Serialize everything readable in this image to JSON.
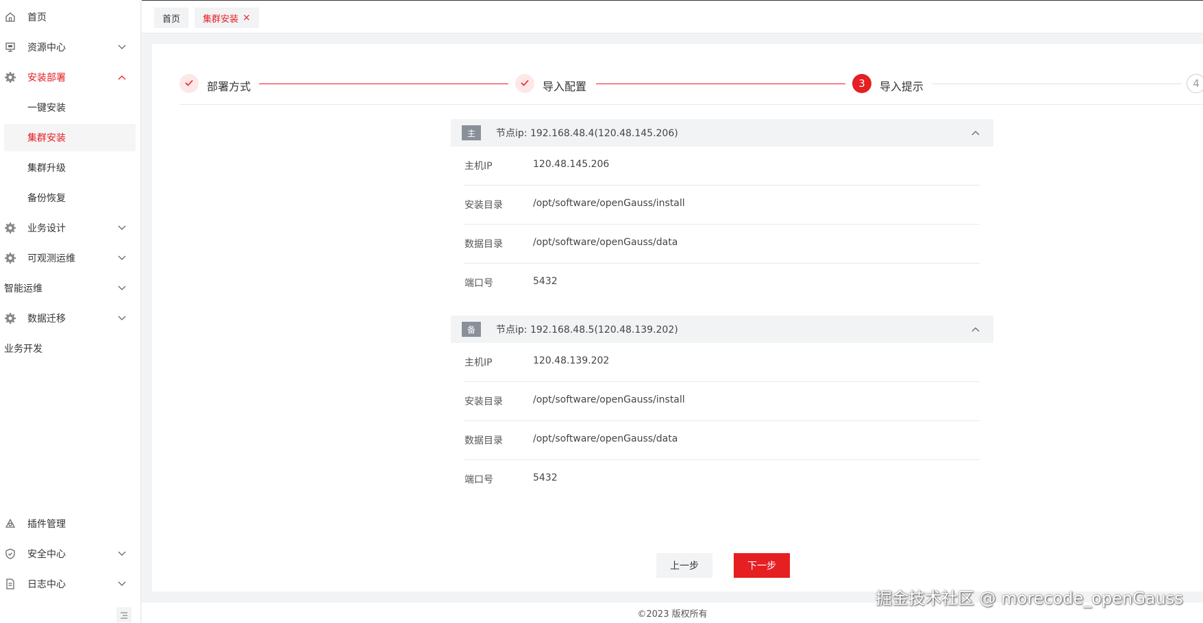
{
  "sidebar": {
    "items": [
      {
        "label": "首页",
        "icon": "home-icon"
      },
      {
        "label": "资源中心",
        "icon": "monitor-icon"
      },
      {
        "label": "安装部署",
        "icon": "gear-icon"
      },
      {
        "label": "一键安装"
      },
      {
        "label": "集群安装"
      },
      {
        "label": "集群升级"
      },
      {
        "label": "备份恢复"
      },
      {
        "label": "业务设计",
        "icon": "gear-icon"
      },
      {
        "label": "可观测运维",
        "icon": "gear-icon"
      },
      {
        "label": "智能运维"
      },
      {
        "label": "数据迁移",
        "icon": "gear-icon"
      },
      {
        "label": "业务开发"
      },
      {
        "label": "插件管理",
        "icon": "plugin-icon"
      },
      {
        "label": "安全中心",
        "icon": "shield-icon"
      },
      {
        "label": "日志中心",
        "icon": "document-icon"
      }
    ]
  },
  "tabs": [
    {
      "label": "首页"
    },
    {
      "label": "集群安装",
      "close": "×"
    }
  ],
  "steps": [
    {
      "label": "部署方式",
      "status": "done"
    },
    {
      "label": "导入配置",
      "status": "done"
    },
    {
      "label": "导入提示",
      "status": "current",
      "num": "3"
    },
    {
      "label": "",
      "status": "todo",
      "num": "4"
    }
  ],
  "nodes": [
    {
      "badge": "主",
      "title": "节点ip: 192.168.48.4(120.48.145.206)",
      "rows": [
        {
          "key": "主机IP",
          "value": "120.48.145.206"
        },
        {
          "key": "安装目录",
          "value": "/opt/software/openGauss/install"
        },
        {
          "key": "数据目录",
          "value": "/opt/software/openGauss/data"
        },
        {
          "key": "端口号",
          "value": "5432"
        }
      ]
    },
    {
      "badge": "备",
      "title": "节点ip: 192.168.48.5(120.48.139.202)",
      "rows": [
        {
          "key": "主机IP",
          "value": "120.48.139.202"
        },
        {
          "key": "安装目录",
          "value": "/opt/software/openGauss/install"
        },
        {
          "key": "数据目录",
          "value": "/opt/software/openGauss/data"
        },
        {
          "key": "端口号",
          "value": "5432"
        }
      ]
    }
  ],
  "buttons": {
    "prev": "上一步",
    "next": "下一步"
  },
  "footer": "©2023 版权所有",
  "watermark": "掘金技术社区 @ morecode_openGauss",
  "colors": {
    "accent": "#e51f22",
    "badge": "#8a9099"
  }
}
